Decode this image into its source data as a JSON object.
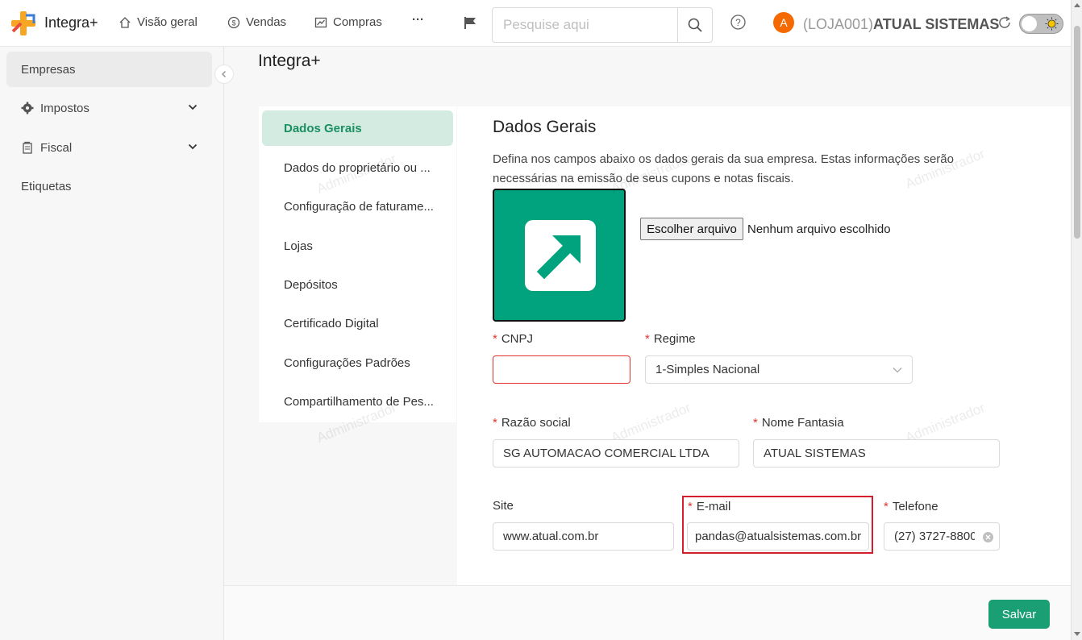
{
  "app": {
    "brand": "Integra+",
    "nav": [
      {
        "label": "Visão geral",
        "icon": "home-icon"
      },
      {
        "label": "Vendas",
        "icon": "dollar-icon"
      },
      {
        "label": "Compras",
        "icon": "chart-icon"
      },
      {
        "label": "···",
        "icon": "more-icon"
      }
    ],
    "search_placeholder": "Pesquise aqui",
    "avatar_letter": "A",
    "company_prefix": "(LOJA001)",
    "company_name": "ATUAL SISTEMAS"
  },
  "sidebar": {
    "items": [
      {
        "label": "Empresas",
        "active": true
      },
      {
        "label": "Impostos",
        "icon": "gear-icon",
        "expandable": true
      },
      {
        "label": "Fiscal",
        "icon": "document-icon",
        "expandable": true
      },
      {
        "label": "Etiquetas"
      }
    ]
  },
  "page": {
    "title": "Integra+",
    "submenu": [
      {
        "label": "Dados Gerais",
        "active": true
      },
      {
        "label": "Dados do proprietário ou ..."
      },
      {
        "label": "Configuração de faturame..."
      },
      {
        "label": "Lojas"
      },
      {
        "label": "Depósitos"
      },
      {
        "label": "Certificado Digital"
      },
      {
        "label": "Configurações Padrões"
      },
      {
        "label": "Compartilhamento de Pes..."
      }
    ],
    "section_title": "Dados Gerais",
    "description": "Defina nos campos abaixo os dados gerais da sua empresa. Estas informações serão necessárias na emissão de seus cupons e notas fiscais.",
    "file_button": "Escolher arquivo",
    "file_status": "Nenhum arquivo escolhido",
    "watermark": "Administrador",
    "fields": {
      "cnpj": {
        "label": "CNPJ",
        "required": true,
        "value": ""
      },
      "regime": {
        "label": "Regime",
        "required": true,
        "value": "1-Simples Nacional"
      },
      "razao_social": {
        "label": "Razão social",
        "required": true,
        "value": "SG AUTOMACAO COMERCIAL LTDA"
      },
      "nome_fantasia": {
        "label": "Nome Fantasia",
        "required": true,
        "value": "ATUAL SISTEMAS"
      },
      "site": {
        "label": "Site",
        "required": false,
        "value": "www.atual.com.br"
      },
      "email": {
        "label": "E-mail",
        "required": true,
        "value": "pandas@atualsistemas.com.br"
      },
      "telefone": {
        "label": "Telefone",
        "required": true,
        "value": "(27) 3727-8800"
      }
    },
    "save_button": "Salvar"
  },
  "colors": {
    "accent": "#1a9e74",
    "logo_bg": "#01a37e",
    "error": "#e3342f",
    "highlight": "#d21f2b"
  }
}
